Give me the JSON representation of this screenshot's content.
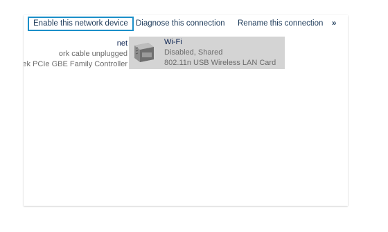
{
  "toolbar": {
    "enable_label": "Enable this network device",
    "diagnose_label": "Diagnose this connection",
    "rename_label": "Rename this connection",
    "more_label": "»"
  },
  "connections": [
    {
      "name": "net",
      "status": "ork cable unplugged",
      "adapter": "ek PCIe GBE Family Controller"
    },
    {
      "name": "Wi-Fi",
      "status": "Disabled, Shared",
      "adapter": "802.11n USB Wireless LAN Card",
      "icon": "network-adapter-icon",
      "selected": true
    }
  ],
  "colors": {
    "accent": "#1b8fc9",
    "selection_bg": "#d4d4d4",
    "toolbar_text": "#1e3b5a",
    "name_text": "#0b2250",
    "detail_text": "#6b6b6b"
  }
}
